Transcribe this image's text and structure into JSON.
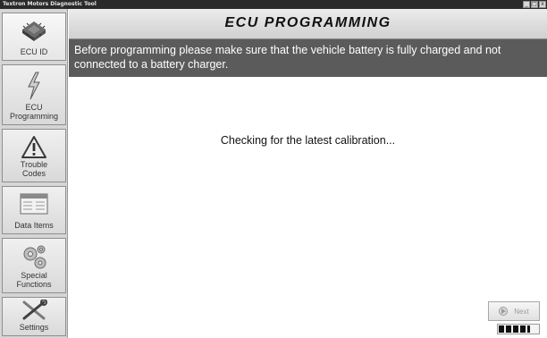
{
  "window": {
    "title": "Textron Motors Diagnostic Tool",
    "minimize": "_",
    "maximize": "□",
    "close": "x"
  },
  "sidebar": {
    "items": [
      {
        "label": "ECU ID",
        "icon": "chip-icon",
        "active": true
      },
      {
        "label": "ECU\nProgramming",
        "icon": "lightning-icon"
      },
      {
        "label": "Trouble\nCodes",
        "icon": "warning-triangle-icon"
      },
      {
        "label": "Data Items",
        "icon": "data-table-icon"
      },
      {
        "label": "Special\nFunctions",
        "icon": "gears-icon"
      },
      {
        "label": "Settings",
        "icon": "tools-icon"
      }
    ]
  },
  "header": {
    "title": "ECU PROGRAMMING"
  },
  "banner": {
    "text": "Before programming please make sure that the vehicle battery is fully charged and not connected to a battery charger."
  },
  "main": {
    "status_text": "Checking for the latest calibration...",
    "next_label": "Next",
    "progress": 0.8
  },
  "colors": {
    "banner_bg": "#5b5b5b",
    "sidebar_bg": "#d5d5d5",
    "titlebar_bg": "#2a2a2a"
  }
}
